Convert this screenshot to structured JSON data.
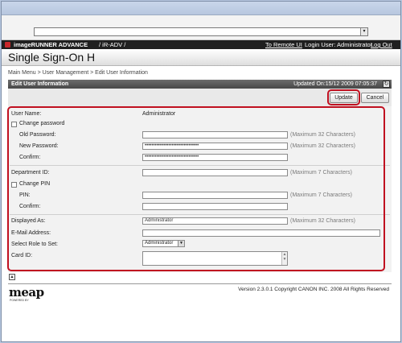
{
  "browser": {
    "address_value": "",
    "address_dropdown_icon": "chevron-down-icon"
  },
  "header": {
    "brand": "imageRUNNER ADVANCE",
    "device": "/ iR-ADV /",
    "remote_ui_link": "To Remote UI",
    "login_user": "Login User: Administrator",
    "logout_link": "Log Out"
  },
  "page": {
    "title": "Single Sign-On H",
    "breadcrumb": "Main Menu > User Management  > Edit User Information"
  },
  "section": {
    "title": "Edit User Information",
    "updated": "Updated On:15/12 2009 07:05:37",
    "refresh_icon": "refresh-icon"
  },
  "buttons": {
    "update": "Update",
    "cancel": "Cancel"
  },
  "form": {
    "user_name_label": "User Name:",
    "user_name_value": "Administrator",
    "change_password_label": "Change password",
    "old_password_label": "Old Password:",
    "old_password_value": "",
    "new_password_label": "New Password:",
    "new_password_value": "••••••••••••••••••••••••••••••••",
    "confirm_label": "Confirm:",
    "confirm_value": "••••••••••••••••••••••••••••••••",
    "hint_32": "(Maximum 32 Characters)",
    "department_label": "Department ID:",
    "department_value": "",
    "hint_7": "(Maximum 7 Characters)",
    "change_pin_label": "Change PIN",
    "pin_label": "PIN:",
    "pin_value": "",
    "pin_confirm_label": "Confirm:",
    "pin_confirm_value": "",
    "displayed_as_label": "Displayed As:",
    "displayed_as_value": "Administrator",
    "email_label": "E-Mail Address:",
    "email_value": "",
    "role_label": "Select Role to Set:",
    "role_value": "Administrator",
    "card_id_label": "Card ID:",
    "card_id_value": ""
  },
  "footer": {
    "logo": "meap",
    "logo_sub": "POWERED BY",
    "copyright": "Version 2.3.0.1 Copyright CANON INC. 2008 All Rights Reserved"
  },
  "colors": {
    "highlight": "#c01020",
    "header_bg": "#202020",
    "brand_red": "#c8282c"
  }
}
